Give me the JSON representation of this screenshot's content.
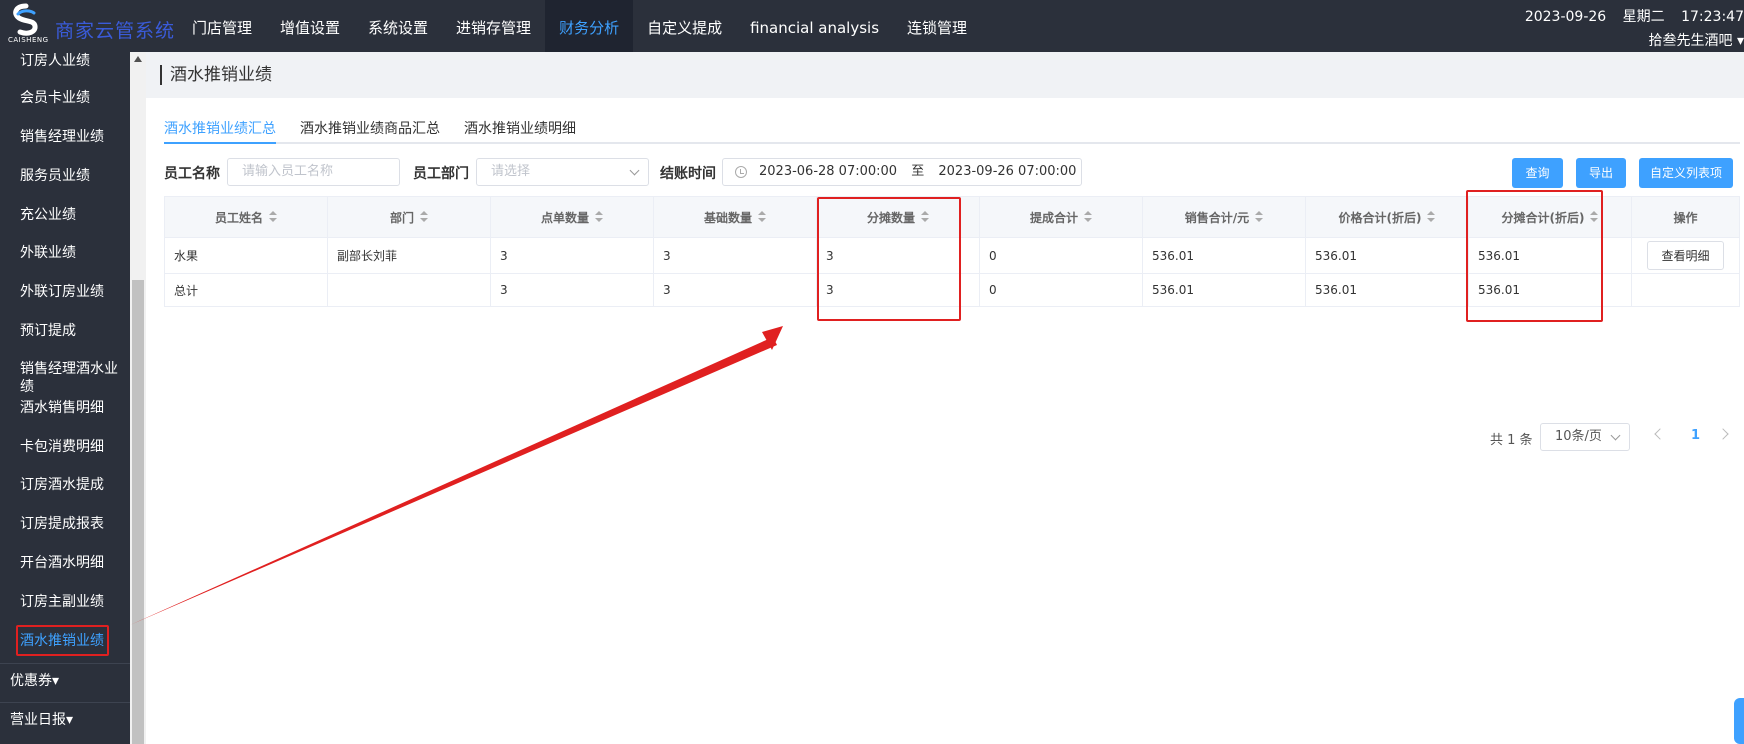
{
  "app": {
    "logo_caption": "CAISHENG",
    "title": "商家云管系统"
  },
  "nav": {
    "items": [
      {
        "label": "门店管理"
      },
      {
        "label": "增值设置"
      },
      {
        "label": "系统设置"
      },
      {
        "label": "进销存管理"
      },
      {
        "label": "财务分析"
      },
      {
        "label": "自定义提成"
      },
      {
        "label": "financial analysis"
      },
      {
        "label": "连锁管理"
      }
    ],
    "active_index": 4
  },
  "header_right": {
    "date": "2023-09-26",
    "weekday": "星期二",
    "time": "17:23:47",
    "user": "拾叁先生酒吧 ▾"
  },
  "sidebar": {
    "items": [
      {
        "label": "订房人业绩"
      },
      {
        "label": "会员卡业绩"
      },
      {
        "label": "销售经理业绩"
      },
      {
        "label": "服务员业绩"
      },
      {
        "label": "充公业绩"
      },
      {
        "label": "外联业绩"
      },
      {
        "label": "外联订房业绩"
      },
      {
        "label": "预订提成"
      },
      {
        "label": "销售经理酒水业绩"
      },
      {
        "label": "酒水销售明细"
      },
      {
        "label": "卡包消费明细"
      },
      {
        "label": "订房酒水提成"
      },
      {
        "label": "订房提成报表"
      },
      {
        "label": "开台酒水明细"
      },
      {
        "label": "订房主副业绩"
      },
      {
        "label": "酒水推销业绩"
      }
    ],
    "groups": [
      {
        "label": "优惠券▾"
      },
      {
        "label": "营业日报▾"
      }
    ]
  },
  "page": {
    "title": "酒水推销业绩"
  },
  "tabs": [
    {
      "label": "酒水推销业绩汇总"
    },
    {
      "label": "酒水推销业绩商品汇总"
    },
    {
      "label": "酒水推销业绩明细"
    }
  ],
  "filters": {
    "name_label": "员工名称",
    "name_placeholder": "请输入员工名称",
    "dept_label": "员工部门",
    "dept_placeholder": "请选择",
    "time_label": "结账时间",
    "date_start": "2023-06-28 07:00:00",
    "date_sep": "至",
    "date_end": "2023-09-26 07:00:00"
  },
  "buttons": {
    "query": "查询",
    "export": "导出",
    "custom_columns": "自定义列表项"
  },
  "table": {
    "headers": [
      "员工姓名",
      "部门",
      "点单数量",
      "基础数量",
      "分摊数量",
      "提成合计",
      "销售合计/元",
      "价格合计(折后)",
      "分摊合计(折后)",
      "操作"
    ],
    "rows": [
      [
        "水果",
        "副部长刘菲",
        "3",
        "3",
        "3",
        "0",
        "536.01",
        "536.01",
        "536.01"
      ],
      [
        "总计",
        "",
        "3",
        "3",
        "3",
        "0",
        "536.01",
        "536.01",
        "536.01"
      ]
    ],
    "row_action": "查看明细"
  },
  "pagination": {
    "total": "共 1 条",
    "page_size": "10条/页",
    "current": "1"
  },
  "colors": {
    "accent": "#3ea1ff",
    "topbar": "#2b303b",
    "annotation": "#e02020"
  }
}
